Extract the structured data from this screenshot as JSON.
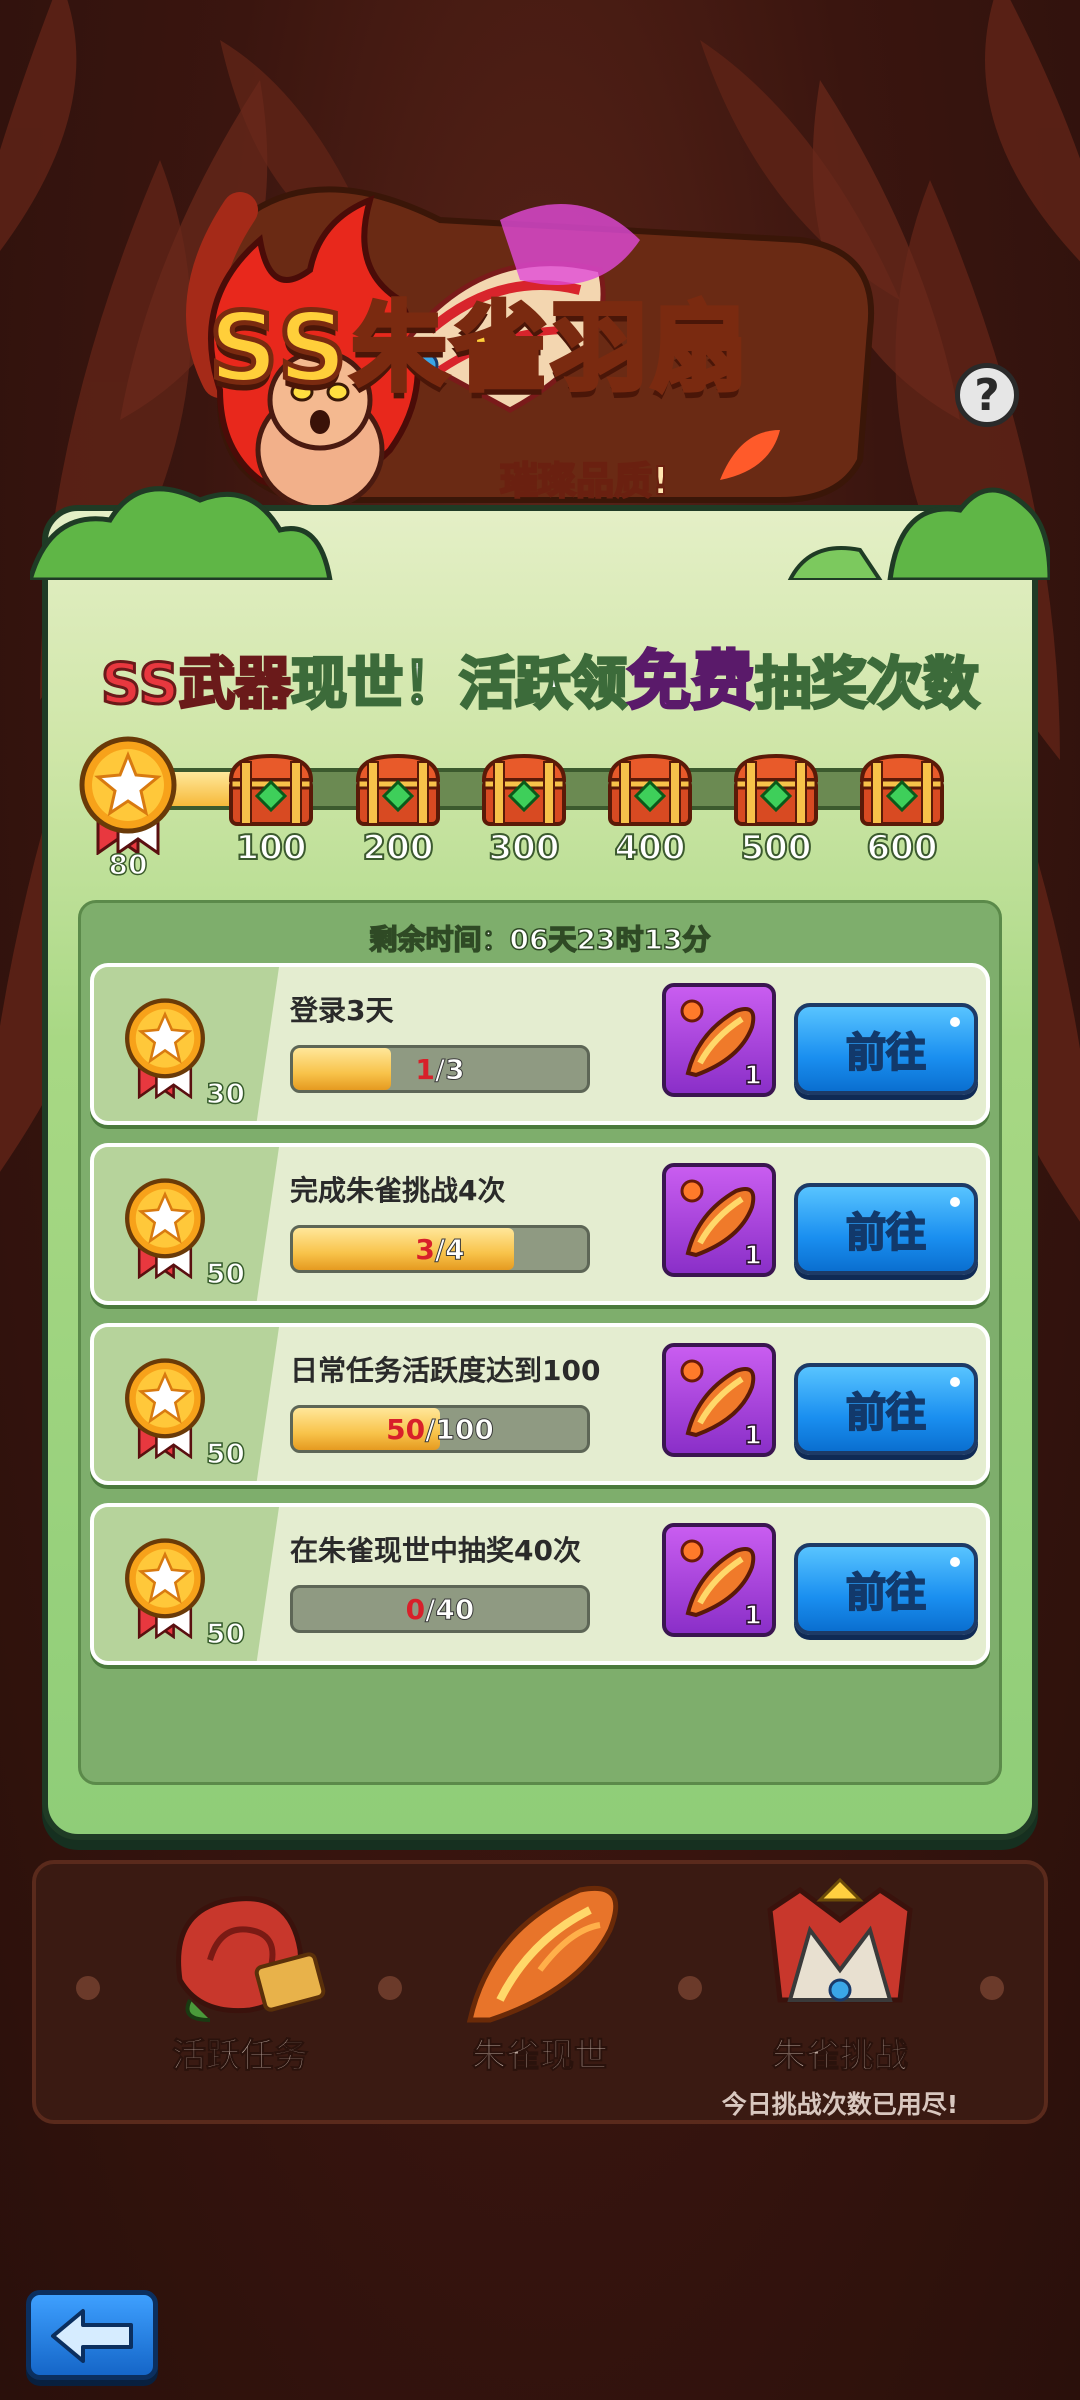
{
  "banner": {
    "title": "SS朱雀羽扇",
    "subtitle": "璀璨品质!"
  },
  "headline": {
    "part1": "SS武器",
    "part2": "现世！活跃领",
    "part3": "免费",
    "part4": "抽奖次数"
  },
  "activity": {
    "current_points": "80",
    "progress_fraction": 0.13,
    "chests": [
      "100",
      "200",
      "300",
      "400",
      "500",
      "600"
    ]
  },
  "timer": "剩余时间：06天23时13分",
  "tasks": [
    {
      "title": "登录3天",
      "points": "30",
      "current": "1",
      "total": "/3",
      "fraction": 0.333,
      "reward_qty": "1",
      "button": "前往"
    },
    {
      "title": "完成朱雀挑战4次",
      "points": "50",
      "current": "3",
      "total": "/4",
      "fraction": 0.75,
      "reward_qty": "1",
      "button": "前往"
    },
    {
      "title": "日常任务活跃度达到100",
      "points": "50",
      "current": "50",
      "total": "/100",
      "fraction": 0.5,
      "reward_qty": "1",
      "button": "前往"
    },
    {
      "title": "在朱雀现世中抽奖40次",
      "points": "50",
      "current": "0",
      "total": "/40",
      "fraction": 0.0,
      "reward_qty": "1",
      "button": "前往"
    }
  ],
  "nav": {
    "items": [
      "活跃任务",
      "朱雀现世",
      "朱雀挑战"
    ],
    "note": "今日挑战次数已用尽!"
  },
  "colors": {
    "panel_green": "#a8d884",
    "go_button_blue": "#1a8ff0",
    "reward_purple": "#8a2fc8",
    "progress_gold": "#f6b93a"
  },
  "icons": [
    "help-icon",
    "medal-star-icon",
    "treasure-chest-icon",
    "feather-icon",
    "back-arrow-icon",
    "rose-icon",
    "crown-emblem-icon"
  ]
}
